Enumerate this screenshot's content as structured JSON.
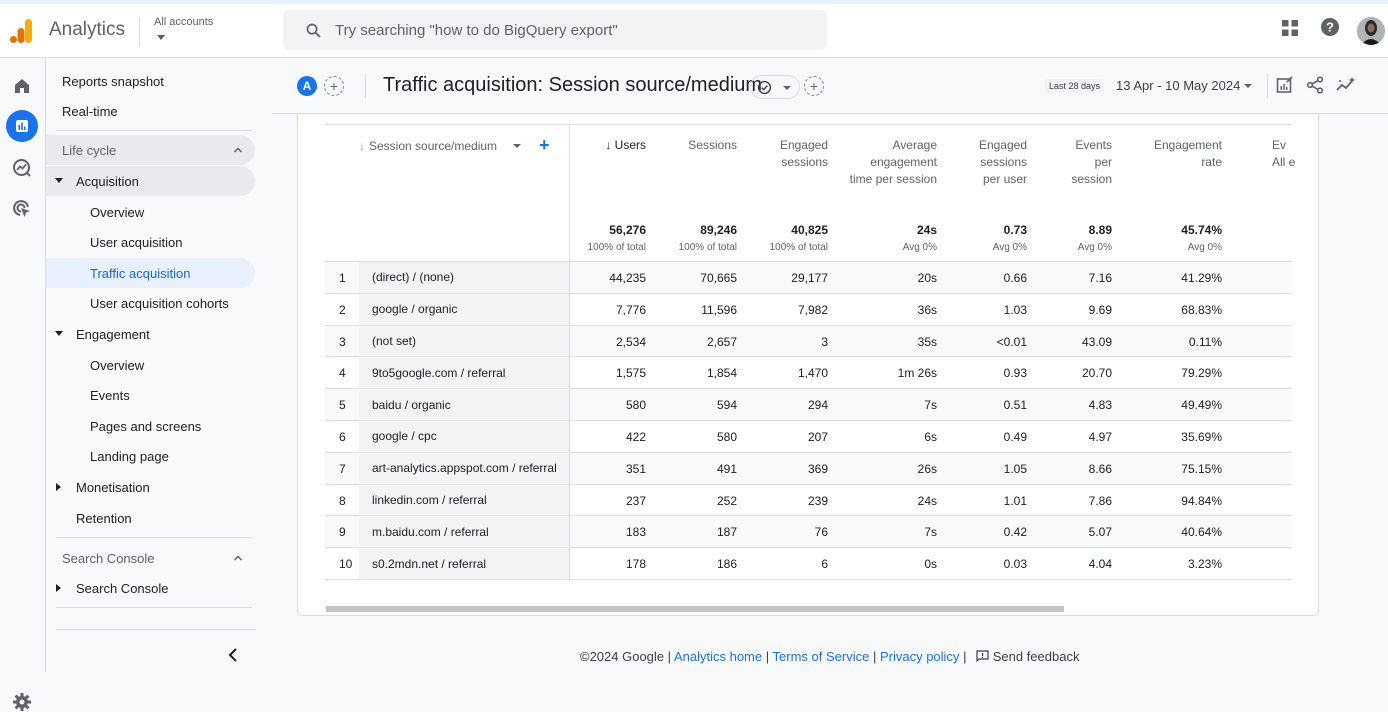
{
  "app": {
    "name": "Analytics",
    "account_label": "All accounts",
    "search_placeholder": "Try searching \"how to do BigQuery export\"",
    "brand_color": "#1a73e8"
  },
  "nav": {
    "items": [
      {
        "label": "Reports snapshot",
        "level": 0
      },
      {
        "label": "Real-time",
        "level": 0
      },
      {
        "label": "Life cycle",
        "type": "section",
        "expanded": true
      },
      {
        "label": "Acquisition",
        "level": 1,
        "expanded": true
      },
      {
        "label": "Overview",
        "level": 2
      },
      {
        "label": "User acquisition",
        "level": 2
      },
      {
        "label": "Traffic acquisition",
        "level": 2,
        "selected": true
      },
      {
        "label": "User acquisition cohorts",
        "level": 2
      },
      {
        "label": "Engagement",
        "level": 1,
        "expanded": true
      },
      {
        "label": "Overview",
        "level": 2
      },
      {
        "label": "Events",
        "level": 2
      },
      {
        "label": "Pages and screens",
        "level": 2
      },
      {
        "label": "Landing page",
        "level": 2
      },
      {
        "label": "Monetisation",
        "level": 1,
        "expanded": false
      },
      {
        "label": "Retention",
        "level": 1
      },
      {
        "label": "Search Console",
        "type": "section",
        "expanded": true
      },
      {
        "label": "Search Console",
        "level": 1,
        "expanded": false
      }
    ]
  },
  "header": {
    "comparison_badge": "A",
    "title": "Traffic acquisition: Session source/medium",
    "date_chip": "Last 28 days",
    "date_range": "13 Apr - 10 May 2024"
  },
  "table": {
    "dimension_header": "Session source/medium",
    "columns": [
      {
        "label": "Users",
        "sorted": true,
        "total": "56,276",
        "sub": "100% of total"
      },
      {
        "label": "Sessions",
        "total": "89,246",
        "sub": "100% of total"
      },
      {
        "label": "Engaged sessions",
        "total": "40,825",
        "sub": "100% of total"
      },
      {
        "label": "Average engagement time per session",
        "total": "24s",
        "sub": "Avg 0%"
      },
      {
        "label": "Engaged sessions per user",
        "total": "0.73",
        "sub": "Avg 0%"
      },
      {
        "label": "Events per session",
        "total": "8.89",
        "sub": "Avg 0%"
      },
      {
        "label": "Engagement rate",
        "total": "45.74%",
        "sub": "Avg 0%"
      },
      {
        "label": "Ev",
        "sub_label": "All e",
        "total": "",
        "sub": ""
      }
    ],
    "rows": [
      {
        "n": "1",
        "dim": "(direct) / (none)",
        "v": [
          "44,235",
          "70,665",
          "29,177",
          "20s",
          "0.66",
          "7.16",
          "41.29%"
        ]
      },
      {
        "n": "2",
        "dim": "google / organic",
        "v": [
          "7,776",
          "11,596",
          "7,982",
          "36s",
          "1.03",
          "9.69",
          "68.83%"
        ]
      },
      {
        "n": "3",
        "dim": "(not set)",
        "v": [
          "2,534",
          "2,657",
          "3",
          "35s",
          "<0.01",
          "43.09",
          "0.11%"
        ]
      },
      {
        "n": "4",
        "dim": "9to5google.com / referral",
        "v": [
          "1,575",
          "1,854",
          "1,470",
          "1m 26s",
          "0.93",
          "20.70",
          "79.29%"
        ]
      },
      {
        "n": "5",
        "dim": "baidu / organic",
        "v": [
          "580",
          "594",
          "294",
          "7s",
          "0.51",
          "4.83",
          "49.49%"
        ]
      },
      {
        "n": "6",
        "dim": "google / cpc",
        "v": [
          "422",
          "580",
          "207",
          "6s",
          "0.49",
          "4.97",
          "35.69%"
        ]
      },
      {
        "n": "7",
        "dim": "art-analytics.appspot.com / referral",
        "v": [
          "351",
          "491",
          "369",
          "26s",
          "1.05",
          "8.66",
          "75.15%"
        ]
      },
      {
        "n": "8",
        "dim": "linkedin.com / referral",
        "v": [
          "237",
          "252",
          "239",
          "24s",
          "1.01",
          "7.86",
          "94.84%"
        ]
      },
      {
        "n": "9",
        "dim": "m.baidu.com / referral",
        "v": [
          "183",
          "187",
          "76",
          "7s",
          "0.42",
          "5.07",
          "40.64%"
        ]
      },
      {
        "n": "10",
        "dim": "s0.2mdn.net / referral",
        "v": [
          "178",
          "186",
          "6",
          "0s",
          "0.03",
          "4.04",
          "3.23%"
        ]
      }
    ]
  },
  "footer": {
    "copyright": "©2024 Google",
    "links": [
      "Analytics home",
      "Terms of Service",
      "Privacy policy"
    ],
    "feedback": "Send feedback"
  }
}
